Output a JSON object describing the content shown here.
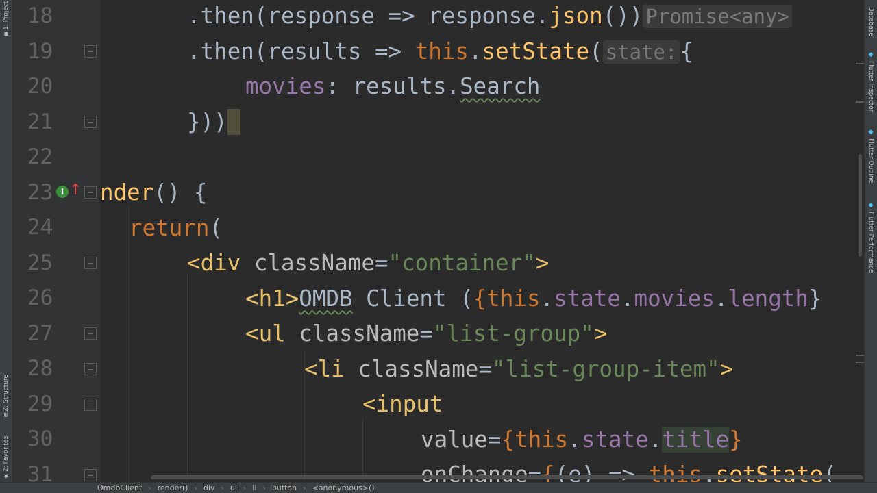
{
  "left_strip": {
    "project_label": "1: Project",
    "structure_label": "Z: Structure",
    "favorites_label": "2: Favorites"
  },
  "right_strip": {
    "database_label": "Database",
    "inspector_label": "Flutter Inspector",
    "outline_label": "Flutter Outline",
    "performance_label": "Flutter Performance"
  },
  "gutter": {
    "line_numbers": [
      "18",
      "19",
      "20",
      "21",
      "22",
      "23",
      "24",
      "25",
      "26",
      "27",
      "28",
      "29",
      "30",
      "31"
    ]
  },
  "code": {
    "l18": {
      "dot_then": ".then",
      "open": "(",
      "param": "response",
      "arrow": " => ",
      "obj": "response",
      "dot": ".",
      "method": "json",
      "close": "())",
      "hint": "Promise<any>"
    },
    "l19": {
      "dot_then": ".then",
      "open": "(",
      "param": "results",
      "arrow": " => ",
      "this": "this",
      "dot": ".",
      "method": "setState",
      "paren": "(",
      "hint": "state:",
      "brace": "{"
    },
    "l20": {
      "key": "movies",
      "colon": ": ",
      "obj": "results",
      "dot": ".",
      "member": "Search"
    },
    "l21": {
      "close": "}))",
      "caret": " "
    },
    "l23": {
      "name": "nder",
      "rest": "() {"
    },
    "l24": {
      "kw": "return",
      "paren": "("
    },
    "l25": {
      "open": "<div",
      "attr": " className",
      "eq": "=",
      "val": "\"container\"",
      "close": ">"
    },
    "l26": {
      "open": "<h1>",
      "omdb": "OMDB",
      "text": " Client (",
      "brace": "{",
      "this": "this",
      "dot1": ".",
      "state": "state",
      "dot2": ".",
      "movies": "movies",
      "dot3": ".",
      "length": "length",
      "tail": "}"
    },
    "l27": {
      "open": "<ul",
      "attr": " className",
      "eq": "=",
      "val": "\"list-group\"",
      "close": ">"
    },
    "l28": {
      "open": "<li",
      "attr": " className",
      "eq": "=",
      "val": "\"list-group-item\"",
      "close": ">"
    },
    "l29": {
      "open": "<input"
    },
    "l30": {
      "attr": "value",
      "eq": "=",
      "brace": "{",
      "this": "this",
      "dot1": ".",
      "state": "state",
      "dot2": ".",
      "title": "title",
      "close": "}"
    },
    "l31": {
      "attr": "onChange",
      "eq": "=",
      "brace": "{",
      "param": "(e)",
      "arrow": " => ",
      "this": "this",
      "dot": ".",
      "method": "setState",
      "paren": "("
    }
  },
  "breadcrumb": {
    "items": [
      "OmdbClient",
      "render()",
      "div",
      "ul",
      "li",
      "button",
      "<anonymous>()"
    ]
  },
  "colors": {
    "background": "#2b2b2b",
    "keyword": "#cc7832",
    "function": "#ffc66d",
    "property": "#9876aa",
    "string": "#6a8759",
    "tag": "#e8bf6a"
  }
}
